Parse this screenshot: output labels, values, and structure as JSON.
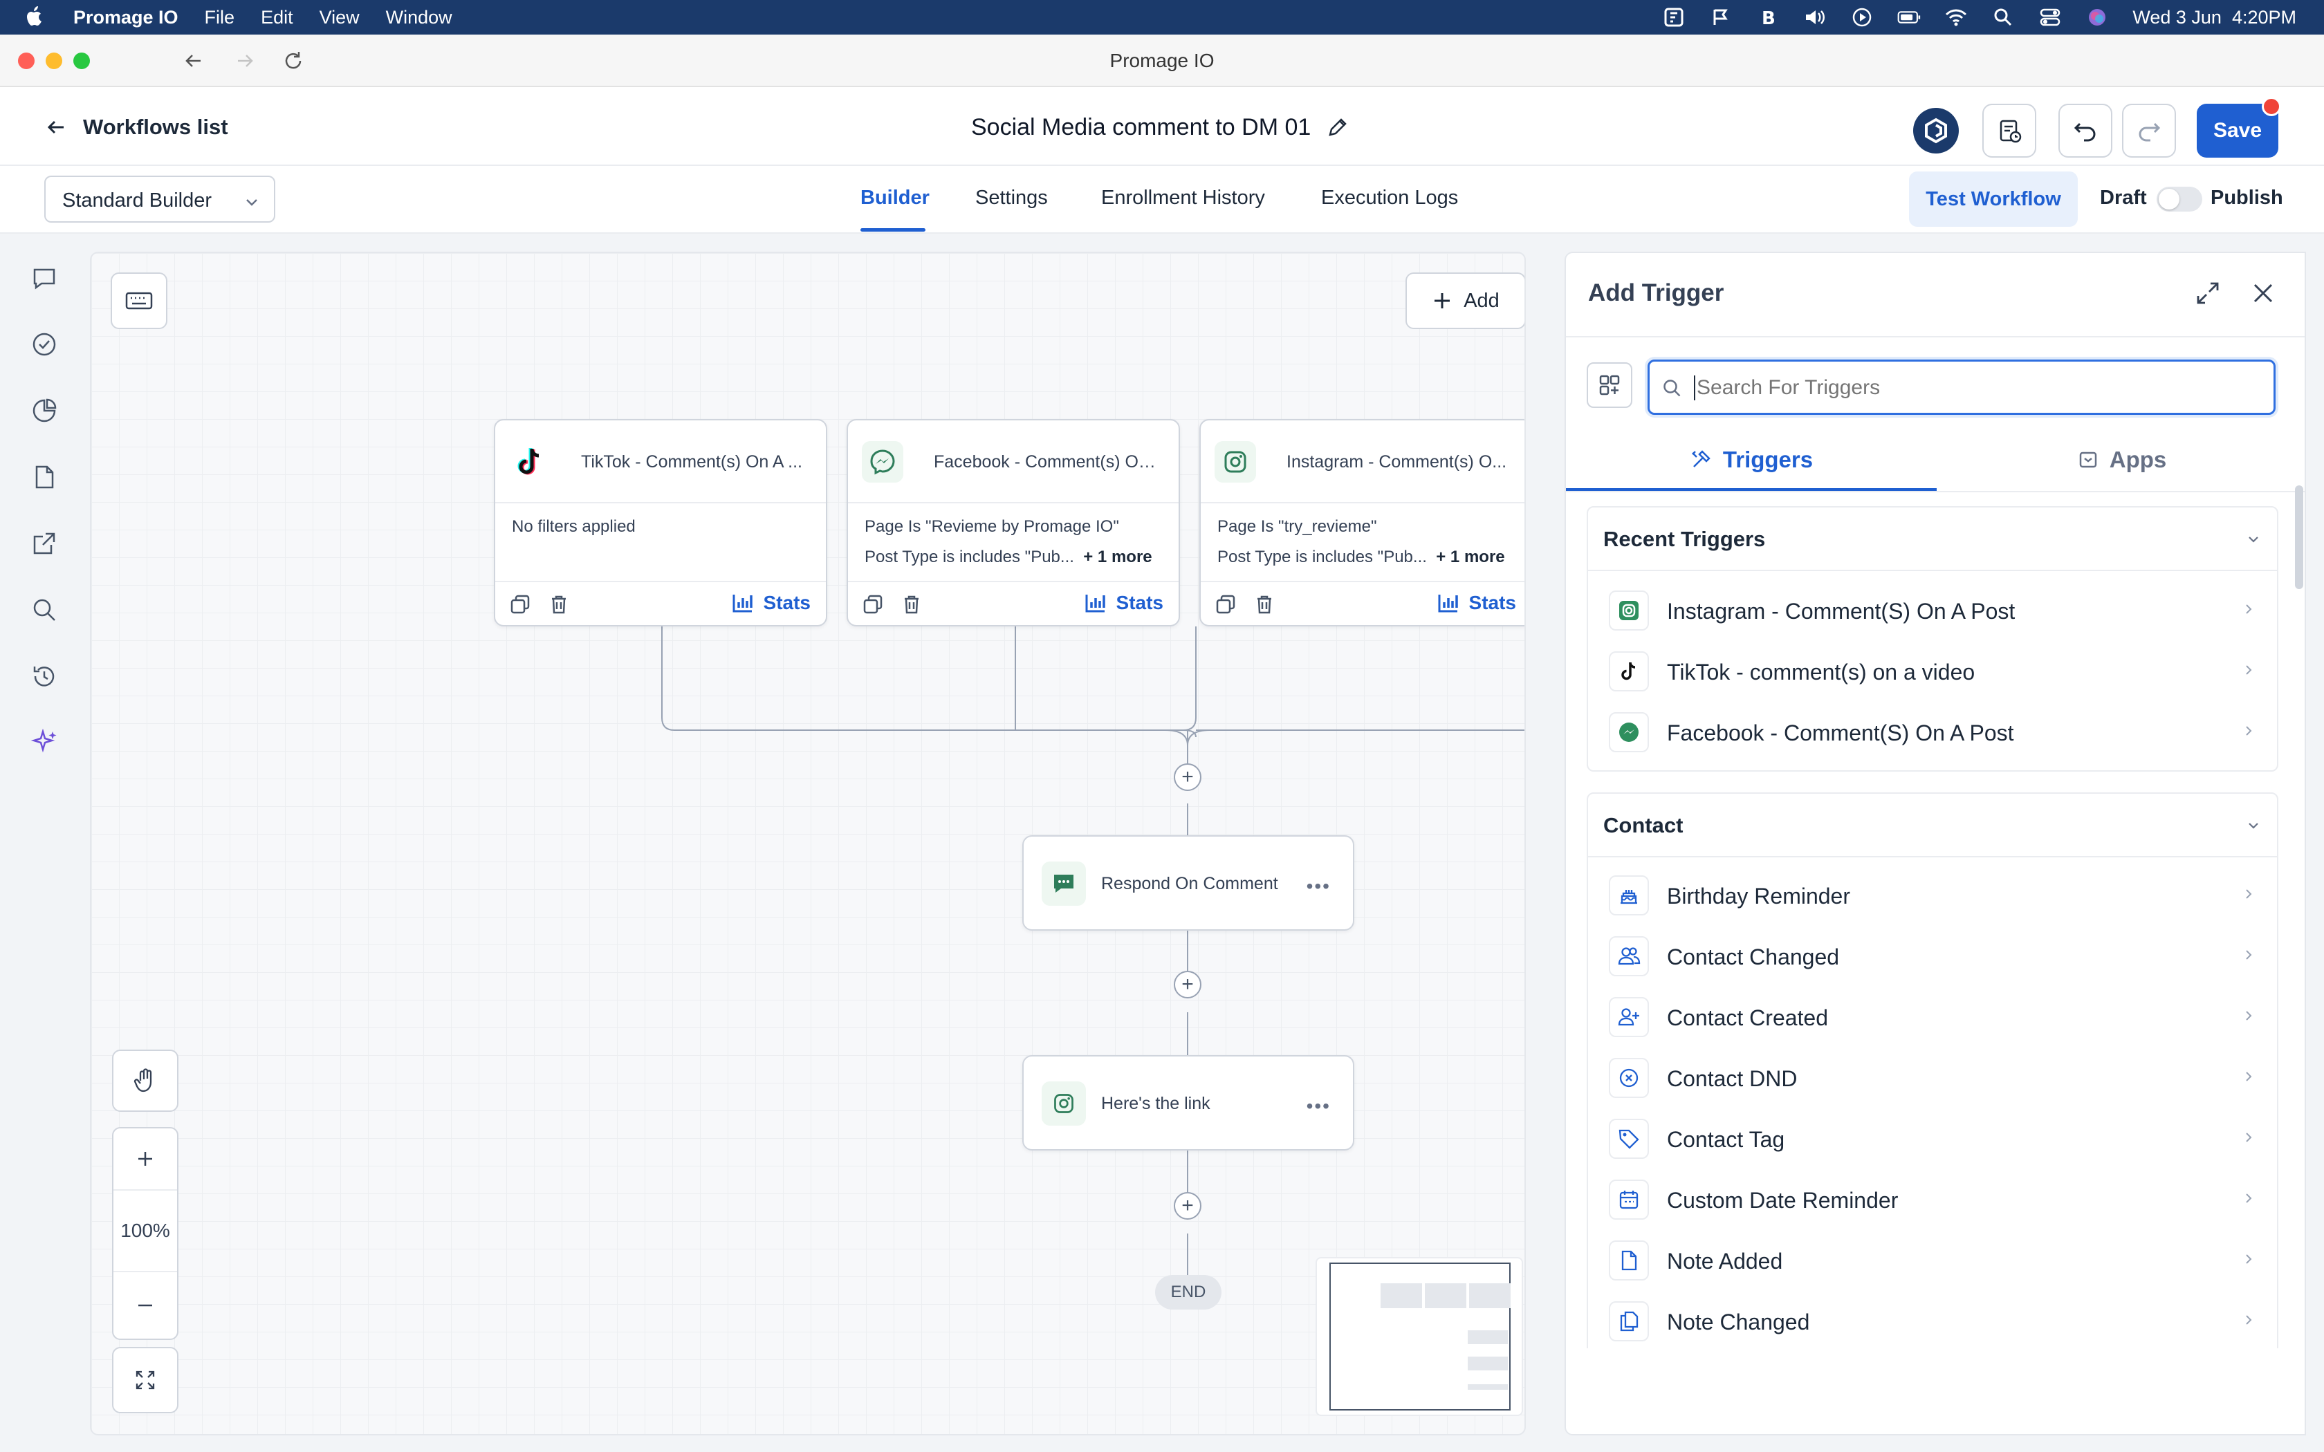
{
  "menubar": {
    "app_name": "Promage IO",
    "menus": [
      "File",
      "Edit",
      "View",
      "Window"
    ],
    "clock": "Wed 3 Jun  4:20PM"
  },
  "window": {
    "title": "Promage IO"
  },
  "header": {
    "back_label": "Workflows list",
    "workflow_name": "Social Media comment to DM 01",
    "save_label": "Save"
  },
  "tabbar": {
    "builder_select": "Standard Builder",
    "tabs": [
      "Builder",
      "Settings",
      "Enrollment History",
      "Execution Logs"
    ],
    "active_tab": "Builder",
    "test_label": "Test Workflow",
    "draft_label": "Draft",
    "publish_label": "Publish"
  },
  "canvas": {
    "add_label": "Add",
    "zoom": "100%",
    "end_label": "END",
    "triggers": [
      {
        "title": "TikTok - Comment(s) On A ...",
        "line1": "No filters applied",
        "line2": "",
        "more": "",
        "stats": "Stats"
      },
      {
        "title": "Facebook - Comment(s) On...",
        "line1": "Page Is \"Revieme by Promage IO\"",
        "line2": "Post Type is includes \"Pub...",
        "more": "+ 1 more",
        "stats": "Stats"
      },
      {
        "title": "Instagram - Comment(s) O...",
        "line1": "Page Is \"try_revieme\"",
        "line2": "Post Type is includes \"Pub...",
        "more": "+ 1 more",
        "stats": "Stats"
      }
    ],
    "actions": [
      {
        "label": "Respond On Comment"
      },
      {
        "label": "Here's the link"
      }
    ]
  },
  "panel": {
    "title": "Add Trigger",
    "search_placeholder": "Search For Triggers",
    "tabs": {
      "triggers": "Triggers",
      "apps": "Apps"
    },
    "recent": {
      "title": "Recent Triggers",
      "items": [
        "Instagram - Comment(S) On A Post",
        "TikTok - comment(s) on a video",
        "Facebook - Comment(S) On A Post"
      ]
    },
    "contact": {
      "title": "Contact",
      "items": [
        "Birthday Reminder",
        "Contact Changed",
        "Contact Created",
        "Contact DND",
        "Contact Tag",
        "Custom Date Reminder",
        "Note Added",
        "Note Changed"
      ]
    }
  },
  "colors": {
    "primary": "#1f5fd1",
    "menubar": "#1b3a6b",
    "save_dot": "#f04438"
  }
}
